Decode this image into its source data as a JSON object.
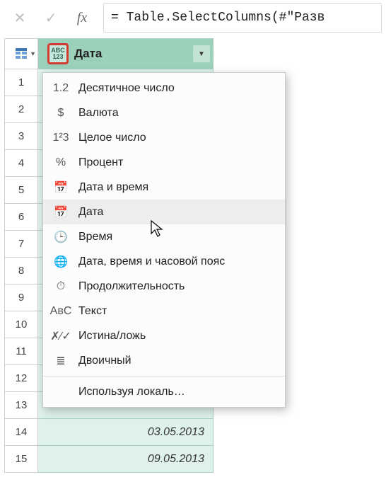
{
  "formula_bar": {
    "cancel_glyph": "✕",
    "accept_glyph": "✓",
    "fx_label": "fx",
    "value": "= Table.SelectColumns(#\"Разв"
  },
  "column": {
    "type_chip_top": "ABC",
    "type_chip_bottom": "123",
    "header_label": "Дата"
  },
  "row_numbers": [
    "1",
    "2",
    "3",
    "4",
    "5",
    "6",
    "7",
    "8",
    "9",
    "10",
    "11",
    "12",
    "13",
    "14",
    "15"
  ],
  "visible_cells": {
    "14": "03.05.2013",
    "15": "09.05.2013"
  },
  "menu": {
    "items": [
      {
        "icon": "1.2",
        "label": "Десятичное число",
        "id": "decimal"
      },
      {
        "icon": "$",
        "label": "Валюта",
        "id": "currency"
      },
      {
        "icon": "1²3",
        "label": "Целое число",
        "id": "integer"
      },
      {
        "icon": "%",
        "label": "Процент",
        "id": "percent"
      },
      {
        "icon": "📅",
        "label": "Дата и время",
        "id": "datetime"
      },
      {
        "icon": "📅",
        "label": "Дата",
        "id": "date",
        "hover": true
      },
      {
        "icon": "🕒",
        "label": "Время",
        "id": "time"
      },
      {
        "icon": "🌐",
        "label": "Дата, время и часовой пояс",
        "id": "datetimezone"
      },
      {
        "icon": "⏱",
        "label": "Продолжительность",
        "id": "duration"
      },
      {
        "icon": "AʙC",
        "label": "Текст",
        "id": "text"
      },
      {
        "icon": "✗⁄✓",
        "label": "Истина/ложь",
        "id": "boolean"
      },
      {
        "icon": "≣",
        "label": "Двоичный",
        "id": "binary"
      }
    ],
    "locale_label": "Используя локаль…"
  }
}
